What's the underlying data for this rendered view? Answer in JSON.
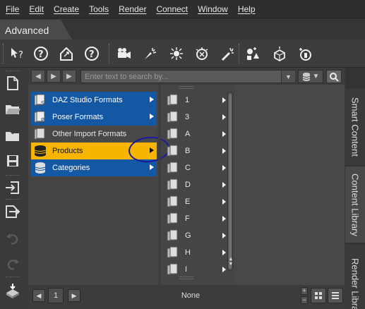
{
  "menubar": {
    "items": [
      "File",
      "Edit",
      "Create",
      "Tools",
      "Render",
      "Connect",
      "Window",
      "Help"
    ]
  },
  "layout": {
    "tab_label": "Advanced"
  },
  "toolbar": {
    "icons": [
      "whats-this-icon",
      "help-icon",
      "home-icon",
      "help-circle-icon",
      "camera-icon",
      "spot-light-icon",
      "point-light-icon",
      "distant-light-icon",
      "linear-light-icon",
      "primitive-icon",
      "node-icon",
      "figure-icon"
    ]
  },
  "search": {
    "placeholder": "Enter text to search by..."
  },
  "categories": [
    {
      "label": "DAZ Studio Formats",
      "state": "blue"
    },
    {
      "label": "Poser Formats",
      "state": "blue"
    },
    {
      "label": "Other Import Formats",
      "state": "plain"
    },
    {
      "label": "Products",
      "state": "selected"
    },
    {
      "label": "Categories",
      "state": "blue"
    }
  ],
  "folders": [
    "1",
    "3",
    "A",
    "B",
    "C",
    "D",
    "E",
    "F",
    "G",
    "H",
    "I"
  ],
  "bottom": {
    "page": "1",
    "status": "None"
  },
  "right_tabs": {
    "smart_content": "Smart Content",
    "content_library": "Content Library",
    "render_library": "Render Library"
  },
  "colors": {
    "selected": "#f7b500",
    "category_blue": "#1458a4",
    "annotation": "#1a1aa0"
  }
}
